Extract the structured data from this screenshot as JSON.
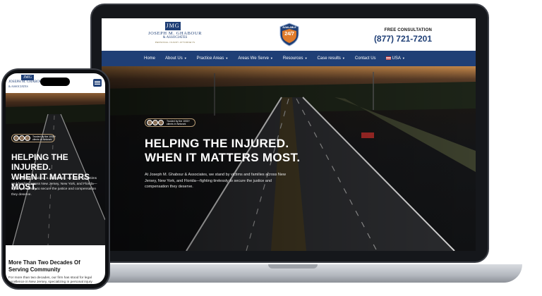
{
  "site": {
    "logo_mark": "JMG",
    "logo_name": "JOSEPH M. GHABOUR",
    "logo_sub": "& ASSOCIATES",
    "logo_tagline": "PERSONAL INJURY ATTORNEYS",
    "badge_available": "AVAILABLE",
    "badge_text": "24/7",
    "consult_label": "FREE CONSULTATION",
    "consult_phone": "(877) 721-7201"
  },
  "nav": {
    "items": [
      "Home",
      "About Us",
      "Practice Areas",
      "Areas We Serve",
      "Resources",
      "Case results",
      "Contact Us",
      "USA"
    ]
  },
  "hero": {
    "trusted": "Trusted by the 1000+ clients in Network",
    "title_line1": "HELPING THE INJURED.",
    "title_line2": "WHEN IT MATTERS MOST.",
    "body": "At Joseph M. Ghabour & Associates, we stand by victims and families across New Jersey, New York, and Florida—fighting tirelessly to secure the justice and compensation they deserve."
  },
  "mobile": {
    "section_title": "More Than Two Decades Of Serving Community",
    "section_body": "For more than two decades, our firm has stood for legal excellence in New Jersey, specializing in personal injury"
  },
  "colors": {
    "brand_navy": "#1f3f76",
    "accent_orange": "#e07b2a"
  }
}
